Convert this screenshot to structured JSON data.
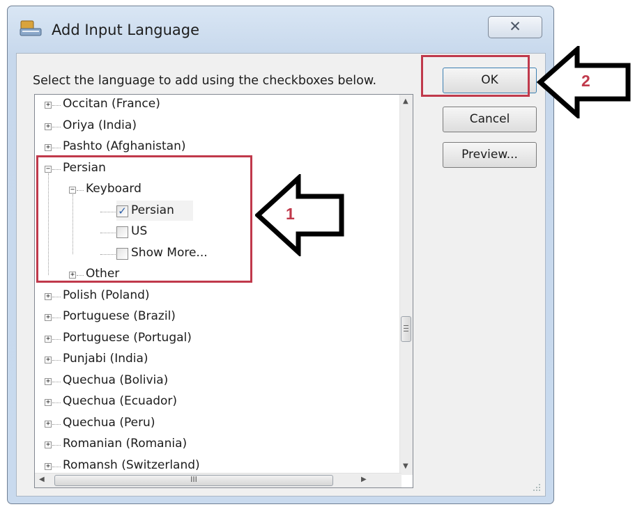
{
  "window": {
    "title": "Add Input Language",
    "close_glyph": "✕"
  },
  "instruction": "Select the language to add using the checkboxes below.",
  "buttons": {
    "ok": "OK",
    "cancel": "Cancel",
    "preview": "Preview..."
  },
  "tree": {
    "languages_before": [
      "Occitan (France)",
      "Oriya (India)",
      "Pashto (Afghanistan)"
    ],
    "expanded_language": "Persian",
    "keyboard_label": "Keyboard",
    "keyboards": [
      {
        "label": "Persian",
        "checked": true
      },
      {
        "label": "US",
        "checked": false
      },
      {
        "label": "Show More...",
        "checked": false
      }
    ],
    "other_label": "Other",
    "languages_after": [
      "Polish (Poland)",
      "Portuguese (Brazil)",
      "Portuguese (Portugal)",
      "Punjabi (India)",
      "Quechua (Bolivia)",
      "Quechua (Ecuador)",
      "Quechua (Peru)",
      "Romanian (Romania)",
      "Romansh (Switzerland)"
    ],
    "hscroll_grip": "III"
  },
  "annotations": {
    "marker_1": "1",
    "marker_2": "2",
    "color": "#c0394b"
  }
}
